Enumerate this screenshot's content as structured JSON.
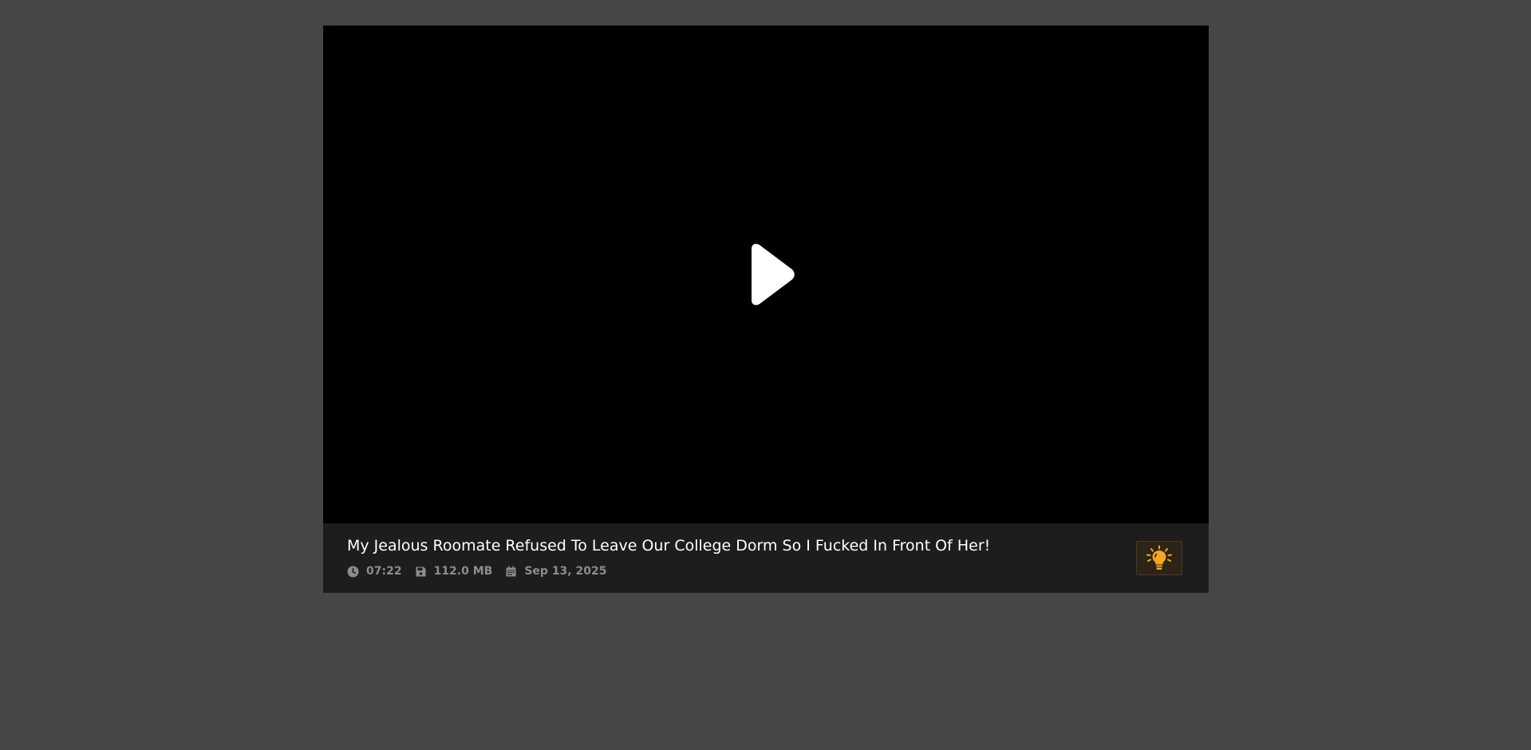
{
  "player": {
    "title": "My Jealous Roomate Refused To Leave Our College Dorm So I Fucked In Front Of Her!",
    "meta": {
      "duration": "07:22",
      "size": "112.0 MB",
      "date": "Sep 13, 2025"
    },
    "icons": {
      "play": "play-icon",
      "duration": "clock-icon",
      "size": "floppy-disk-icon",
      "date": "calendar-icon",
      "light": "lightbulb-icon"
    },
    "colors": {
      "background": "#454646",
      "video": "#000000",
      "info_bar": "#1d1d1d",
      "meta_text": "#8a8c91",
      "light_accent": "#f5a623"
    }
  }
}
